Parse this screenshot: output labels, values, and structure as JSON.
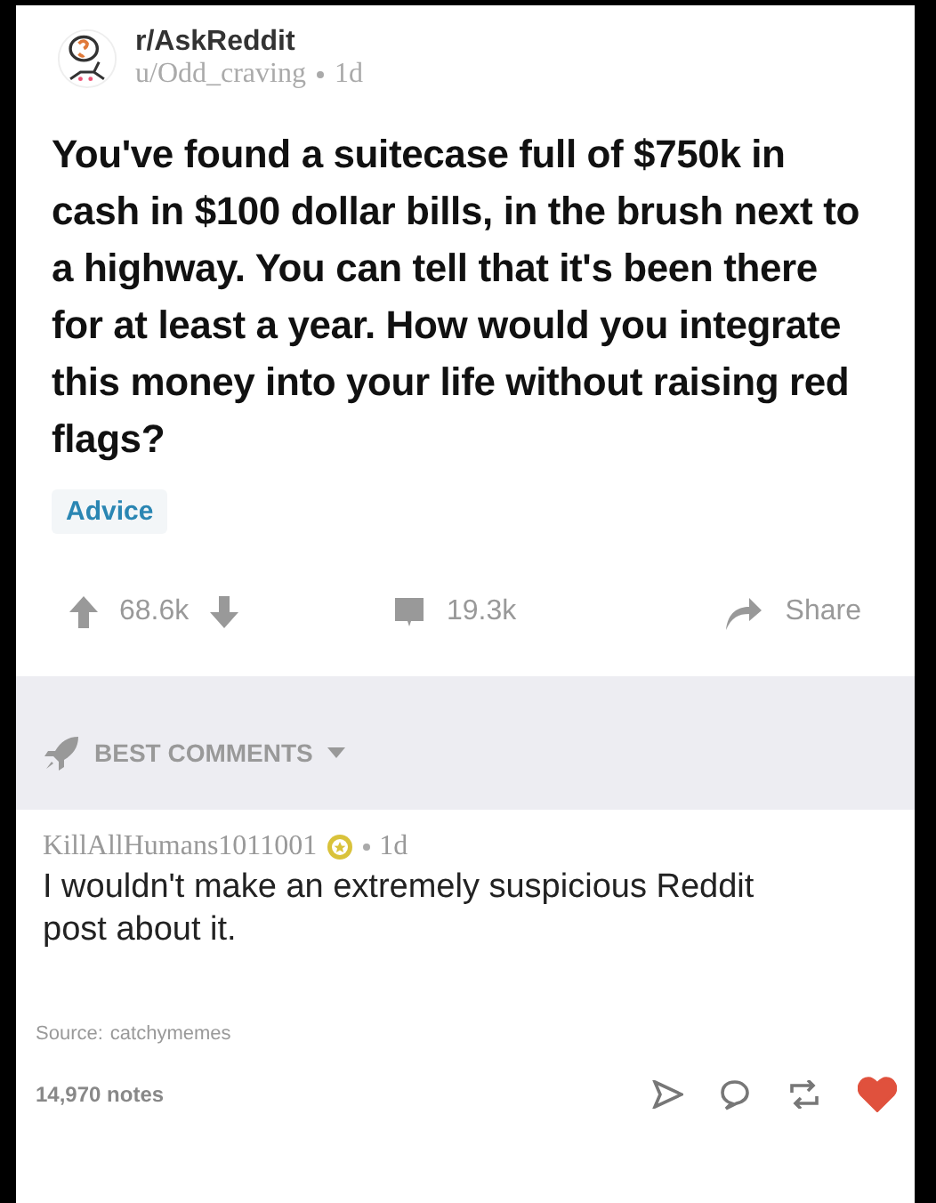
{
  "post": {
    "subreddit": "r/AskReddit",
    "author": "u/Odd_craving",
    "age": "1d",
    "title": "You've found a suitecase full of $750k in cash in $100 dollar bills, in the brush next to a highway. You can tell that it's been there for at least a year. How would you integrate this money into your life without raising red flags?",
    "flair": "Advice",
    "score": "68.6k",
    "comments": "19.3k",
    "share": "Share"
  },
  "comments_header": {
    "sort": "BEST COMMENTS"
  },
  "comment": {
    "author": "KillAllHumans1011001",
    "age": "1d",
    "text": "I wouldn't make an extremely suspicious Reddit post about it."
  },
  "footer": {
    "source_label": "Source:",
    "source": "catchymemes",
    "notes": "14,970 notes",
    "liked": true
  }
}
